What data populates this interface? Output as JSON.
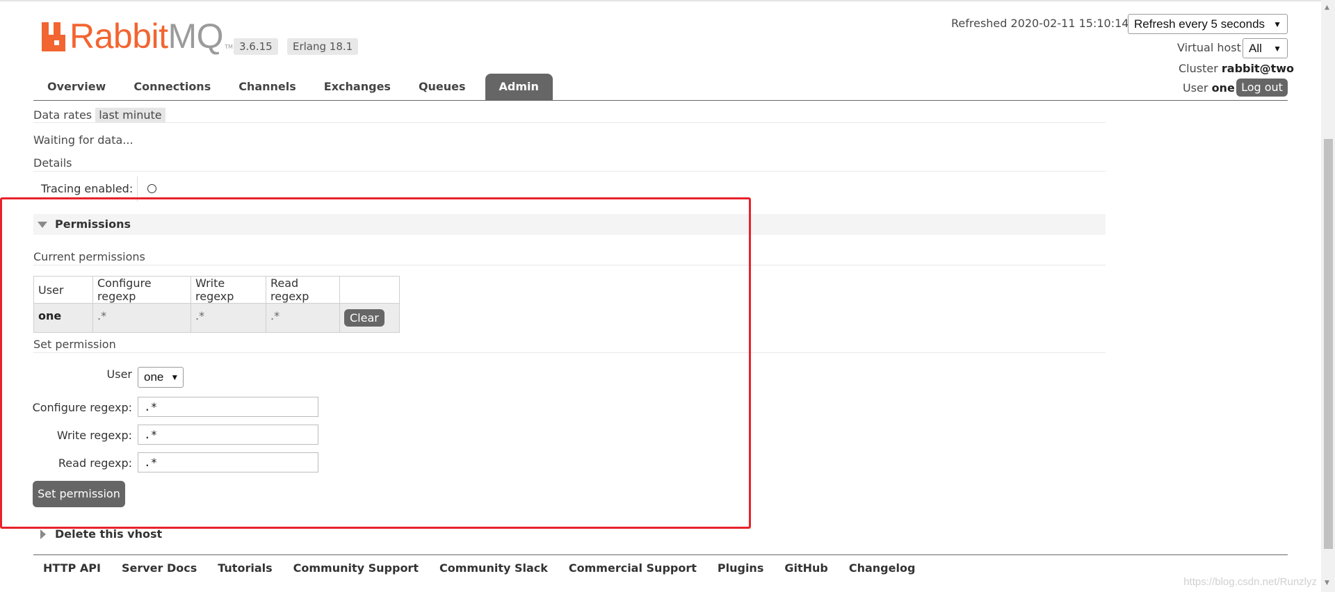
{
  "header": {
    "logo": {
      "brand": "Rabbit",
      "brand_suffix": "MQ",
      "tm": "TM"
    },
    "version": "3.6.15",
    "erlang": "Erlang 18.1",
    "refreshed": "Refreshed 2020-02-11 15:10:14",
    "refresh_select": "Refresh every 5 seconds",
    "virtual_host_label": "Virtual host",
    "virtual_host_value": "All",
    "cluster_label": "Cluster",
    "cluster_value": "rabbit@two",
    "user_label": "User",
    "user_value": "one",
    "logout": "Log out"
  },
  "nav": {
    "tabs": [
      "Overview",
      "Connections",
      "Channels",
      "Exchanges",
      "Queues",
      "Admin"
    ],
    "active": "Admin"
  },
  "data_rates": {
    "label": "Data rates",
    "value": "last minute"
  },
  "waiting": "Waiting for data...",
  "details": {
    "title": "Details",
    "tracing_label": "Tracing enabled:"
  },
  "permissions": {
    "title": "Permissions",
    "current_title": "Current permissions",
    "columns": [
      "User",
      "Configure regexp",
      "Write regexp",
      "Read regexp"
    ],
    "rows": [
      {
        "user": "one",
        "configure": ".*",
        "write": ".*",
        "read": ".*",
        "action": "Clear"
      }
    ],
    "set_title": "Set permission",
    "user_label": "User",
    "user_value": "one",
    "configure_label": "Configure regexp:",
    "configure_value": ".*",
    "write_label": "Write regexp:",
    "write_value": ".*",
    "read_label": "Read regexp:",
    "read_value": ".*",
    "submit": "Set permission"
  },
  "delete_vhost": "Delete this vhost",
  "footer": {
    "links": [
      "HTTP API",
      "Server Docs",
      "Tutorials",
      "Community Support",
      "Community Slack",
      "Commercial Support",
      "Plugins",
      "GitHub",
      "Changelog"
    ]
  },
  "watermark": "https://blog.csdn.net/Runzlyz",
  "colors": {
    "brand": "#f26531",
    "tab_active": "#666666",
    "highlight_box": "#e8222a"
  }
}
